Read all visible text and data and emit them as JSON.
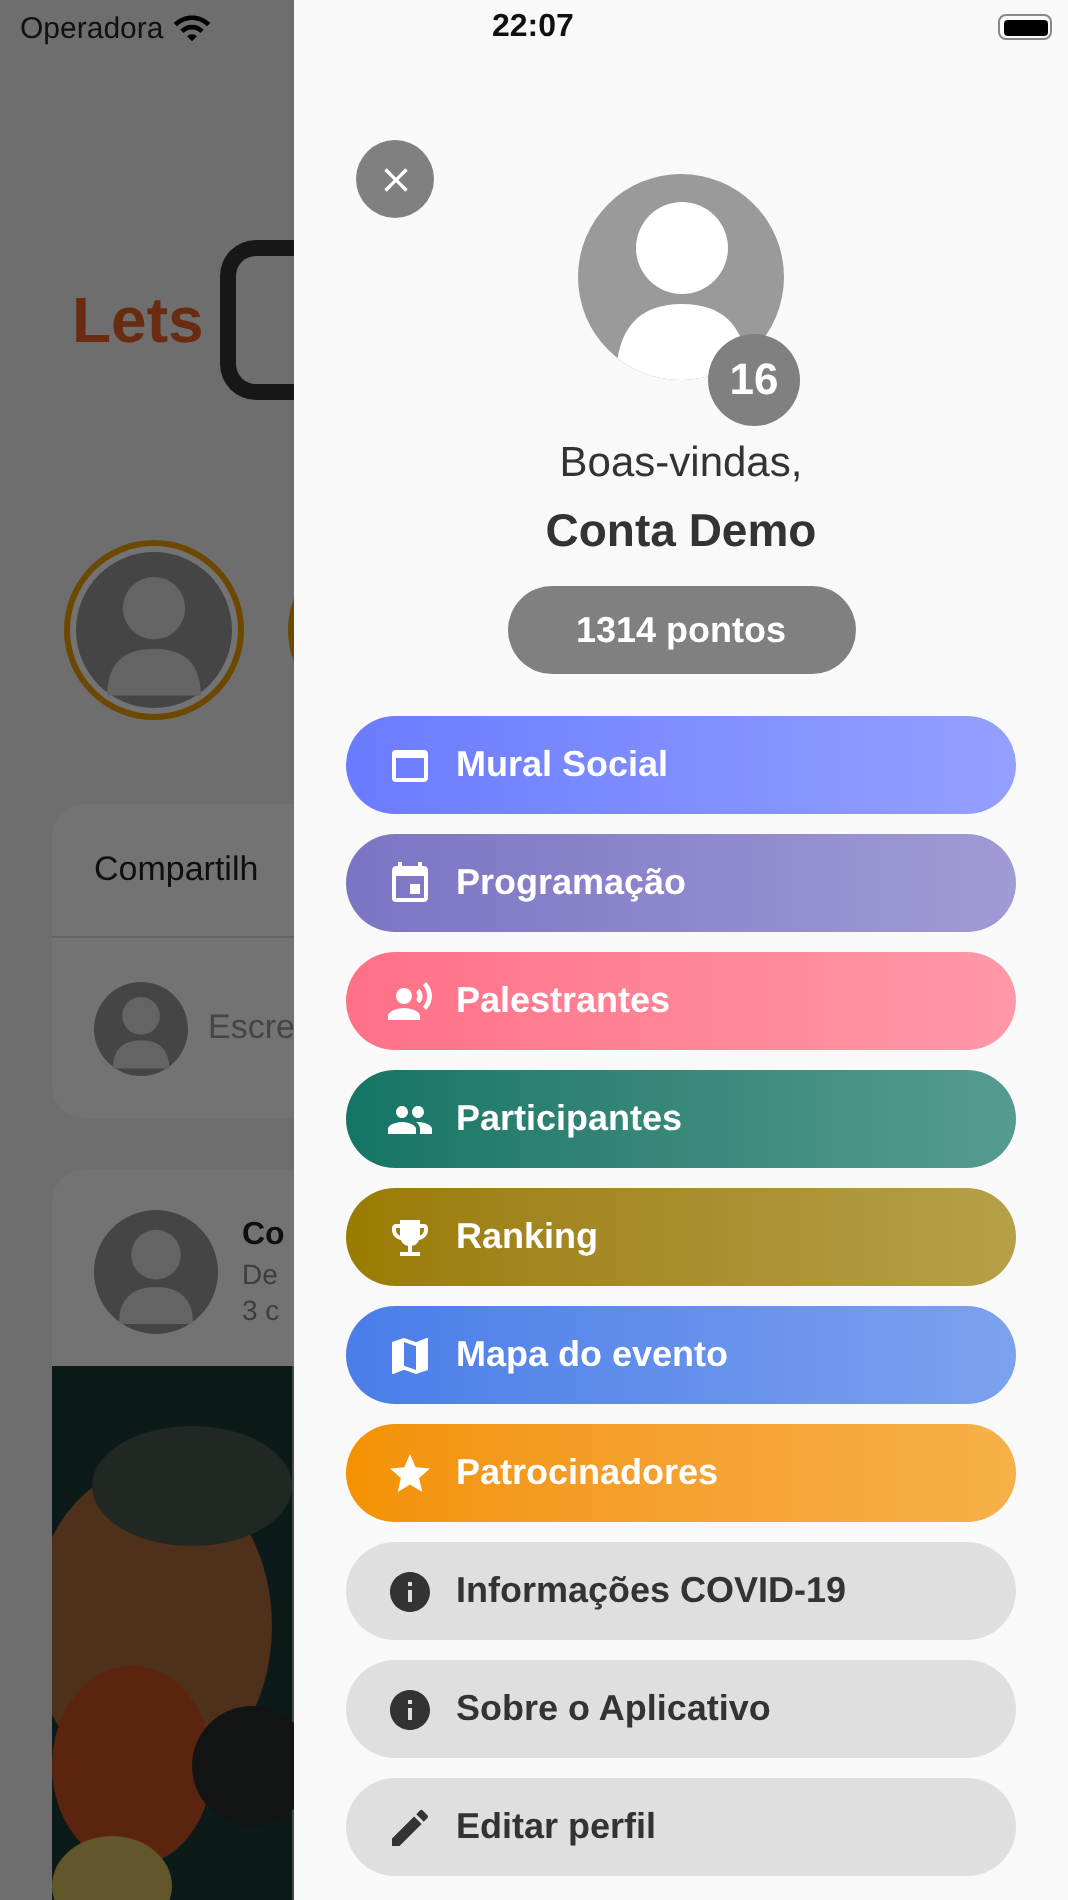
{
  "status_bar": {
    "carrier": "Operadora",
    "time": "22:07"
  },
  "background": {
    "logo": "Lets",
    "share_card": {
      "title": "Compartilh",
      "placeholder": "Escre"
    },
    "post": {
      "author": "Co",
      "line_1": "De",
      "line_2": "3 c"
    }
  },
  "drawer": {
    "level_badge": "16",
    "greeting": "Boas-vindas,",
    "user_name": "Conta Demo",
    "points": "1314 pontos",
    "menu": [
      {
        "label": "Mural Social",
        "kind": "accent",
        "color": "#6b7bff"
      },
      {
        "label": "Programação",
        "kind": "accent",
        "color": "#7b74c4"
      },
      {
        "label": "Palestrantes",
        "kind": "accent",
        "color": "#ff7086"
      },
      {
        "label": "Participantes",
        "kind": "accent",
        "color": "#137565"
      },
      {
        "label": "Ranking",
        "kind": "accent",
        "color": "#9a7b00"
      },
      {
        "label": "Mapa do evento",
        "kind": "accent",
        "color": "#4a7de8"
      },
      {
        "label": "Patrocinadores",
        "kind": "accent",
        "color": "#f39200"
      },
      {
        "label": "Informações COVID-19",
        "kind": "plain"
      },
      {
        "label": "Sobre o Aplicativo",
        "kind": "plain"
      },
      {
        "label": "Editar perfil",
        "kind": "plain"
      }
    ]
  }
}
